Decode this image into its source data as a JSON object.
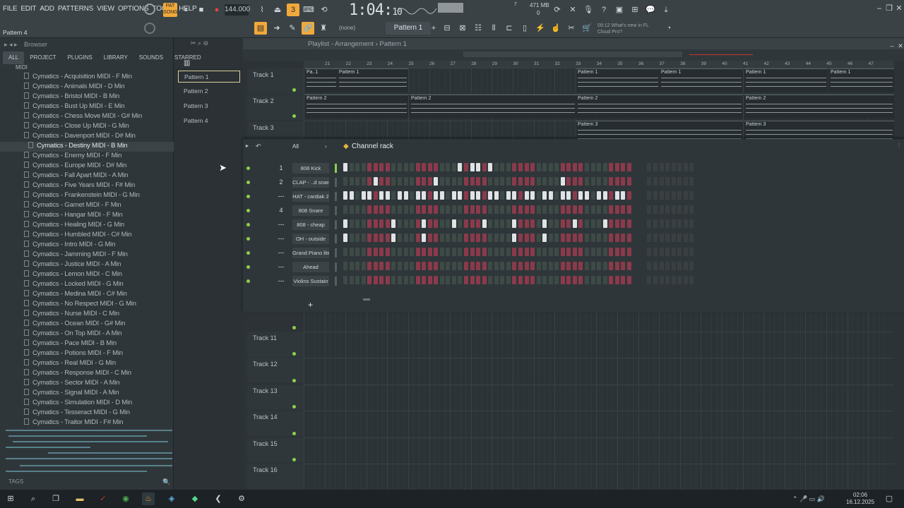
{
  "menu": [
    "FILE",
    "EDIT",
    "ADD",
    "PATTERNS",
    "VIEW",
    "OPTIONS",
    "TOOLS",
    "HELP"
  ],
  "transport": {
    "tempo": "144.000",
    "time_main": "1:04:",
    "time_sub": "10",
    "mem": "471 MB",
    "mem_small": "7",
    "mem_zero": "0"
  },
  "pattern_selector": {
    "current": "Pattern 1",
    "none_label": "(none)",
    "pattern_name_left": "Pattern 4"
  },
  "news": {
    "time": "09:12",
    "text": "What's new in FL",
    "text2": "Cloud Pro?"
  },
  "browser": {
    "title": "Browser",
    "tabs": [
      "ALL",
      "PROJECT",
      "PLUGINS",
      "LIBRARY",
      "SOUNDS",
      "STARRED"
    ],
    "folder": "MIDI",
    "items": [
      "Cymatics - Acquisition MIDI - F Min",
      "Cymatics - Animals MIDI - D Min",
      "Cymatics - Bristol MIDI - B Min",
      "Cymatics - Bust Up MIDI - E Min",
      "Cymatics - Chess Move MIDI - G# Min",
      "Cymatics - Close Up MIDI - G Min",
      "Cymatics - Davenport MIDI - D# Min",
      "Cymatics - Destiny MIDI - B Min",
      "Cymatics - Enemy MIDI - F Min",
      "Cymatics - Europe MIDI - D# Min",
      "Cymatics - Fall Apart MIDI - A Min",
      "Cymatics - Five Years MIDI - F# Min",
      "Cymatics - Frankenstein MIDI - G Min",
      "Cymatics - Garnet MIDI - F Min",
      "Cymatics - Hangar MIDI - F Min",
      "Cymatics - Healing MIDI - G Min",
      "Cymatics - Humbled MIDI - C# Min",
      "Cymatics - Intro MIDI - G Min",
      "Cymatics - Jamming MIDI - F Min",
      "Cymatics - Justice MIDI - A Min",
      "Cymatics - Lemon MIDI - C Min",
      "Cymatics - Locked MIDI - G Min",
      "Cymatics - Medina MIDI - C# Min",
      "Cymatics - No Respect MIDI - G Min",
      "Cymatics - Nurse MIDI - C Min",
      "Cymatics - Ocean MIDI - G# Min",
      "Cymatics - On Top MIDI - A Min",
      "Cymatics - Pace MIDI - B Min",
      "Cymatics - Potions MIDI - F Min",
      "Cymatics - Real MIDI - G Min",
      "Cymatics - Response MIDI - C Min",
      "Cymatics - Sector MIDI - A Min",
      "Cymatics - Signal MIDI - A Min",
      "Cymatics - Simulation MIDI - D Min",
      "Cymatics - Tesseract MIDI - G Min",
      "Cymatics - Traitor MIDI - F# Min"
    ],
    "selected_index": 7,
    "tags": "TAGS"
  },
  "patterns": [
    "Pattern 1",
    "Pattern 2",
    "Pattern 3",
    "Pattern 4"
  ],
  "playlist": {
    "title": "Playlist - Arrangement",
    "sep": "›",
    "pattern": "Pattern 1",
    "ruler": [
      "21",
      "22",
      "23",
      "24",
      "25",
      "26",
      "27",
      "28",
      "29",
      "30",
      "31",
      "32",
      "33",
      "34",
      "35",
      "36",
      "37",
      "38",
      "39",
      "40",
      "41",
      "42",
      "43",
      "44",
      "45",
      "46",
      "47"
    ],
    "tracks_top": [
      "Track 1",
      "Track 2",
      "Track 3"
    ],
    "tracks_bottom": [
      "Track 11",
      "Track 12",
      "Track 13",
      "Track 14",
      "Track 15",
      "Track 16"
    ],
    "clip_labels": {
      "p1": "Pattern 1",
      "p1s": "Pa..1",
      "p2": "Pattern 2",
      "p3": "Pattern 3"
    }
  },
  "channel_rack": {
    "title": "Channel rack",
    "filter": "All",
    "channels": [
      {
        "num": "1",
        "name": "808 Kick",
        "steps": [
          0,
          19,
          21,
          22,
          24
        ]
      },
      {
        "num": "2",
        "name": "CLAP - ..d snare",
        "steps": [
          5,
          15,
          36
        ]
      },
      {
        "num": "---",
        "name": "HAT - cardiak 2",
        "steps": [
          0,
          1,
          3,
          4,
          6,
          7,
          9,
          10,
          12,
          13,
          15,
          16,
          18,
          19,
          21,
          22,
          24,
          25,
          27,
          28,
          30,
          31,
          33,
          34,
          36,
          37,
          39,
          40,
          42,
          43,
          45,
          46
        ]
      },
      {
        "num": "4",
        "name": "808 Snare",
        "steps": []
      },
      {
        "num": "---",
        "name": "808 - cheap",
        "steps": [
          0,
          8,
          13,
          18,
          23,
          28,
          33,
          38,
          43
        ]
      },
      {
        "num": "---",
        "name": "OH - outside",
        "steps": [
          0,
          8,
          13,
          28,
          33
        ]
      },
      {
        "num": "---",
        "name": "Grand Piano lite",
        "steps": []
      },
      {
        "num": "---",
        "name": "Ahead",
        "steps": []
      },
      {
        "num": "---",
        "name": "Violins Sustain",
        "steps": []
      }
    ],
    "add": "+"
  },
  "taskbar": {
    "time": "02:06",
    "date": "16.12.2025"
  }
}
